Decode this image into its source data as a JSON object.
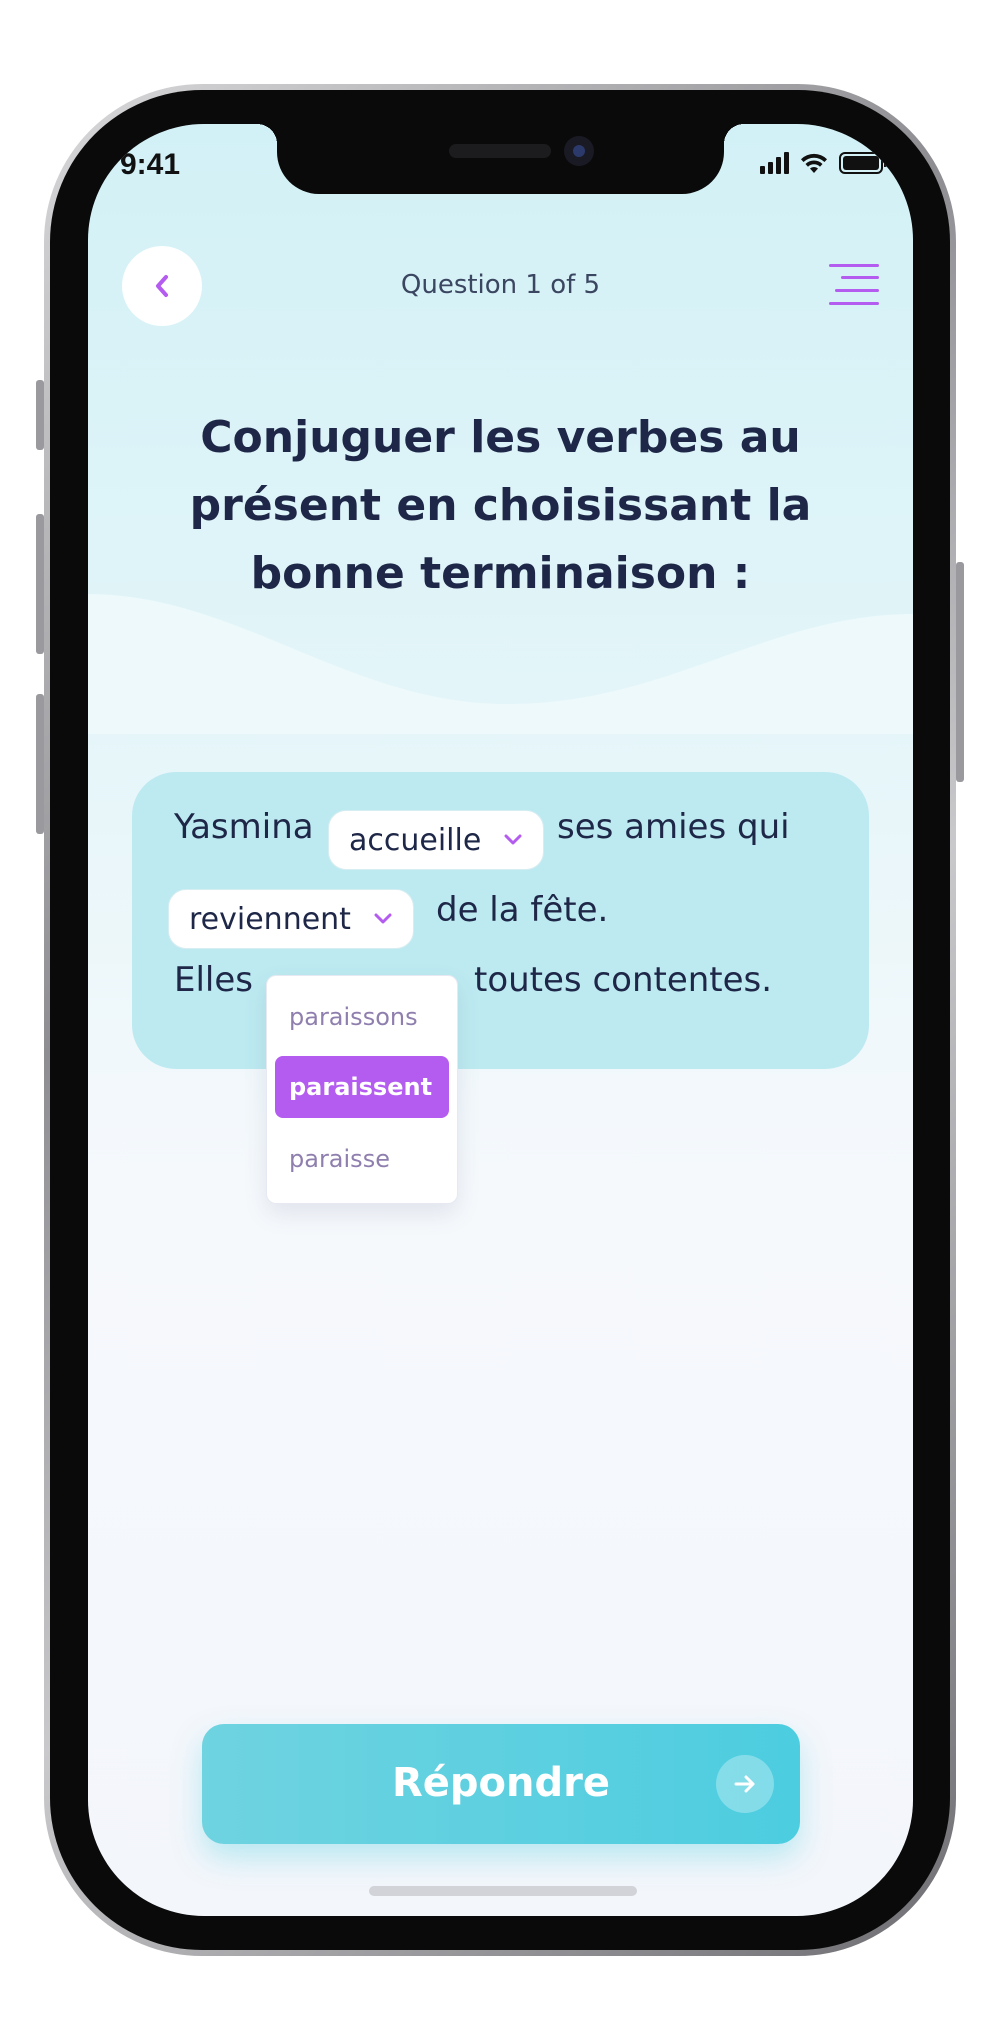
{
  "status_bar": {
    "time": "9:41"
  },
  "header": {
    "question_counter": "Question 1 of 5"
  },
  "question": {
    "title_line1": "Conjuguer les verbes au",
    "title_line2": "présent en choisissant la",
    "title_line3": "bonne terminaison :"
  },
  "exercise": {
    "word_yasmina": "Yasmina",
    "select1_value": "accueille",
    "word_ses_amies_qui": "ses amies qui",
    "select2_value": "reviennent",
    "word_de_la_fete": "de la fête.",
    "word_elles": "Elles",
    "word_toutes_contentes": "toutes contentes."
  },
  "dropdown": {
    "options": [
      "paraissons",
      "paraissent",
      "paraisse"
    ],
    "selected_index": 1
  },
  "submit": {
    "label": "Répondre"
  },
  "colors": {
    "accent_purple": "#b45cf0",
    "accent_cyan": "#4ccde0",
    "text_dark": "#1e2747",
    "card_bg": "#bdeaf1"
  }
}
